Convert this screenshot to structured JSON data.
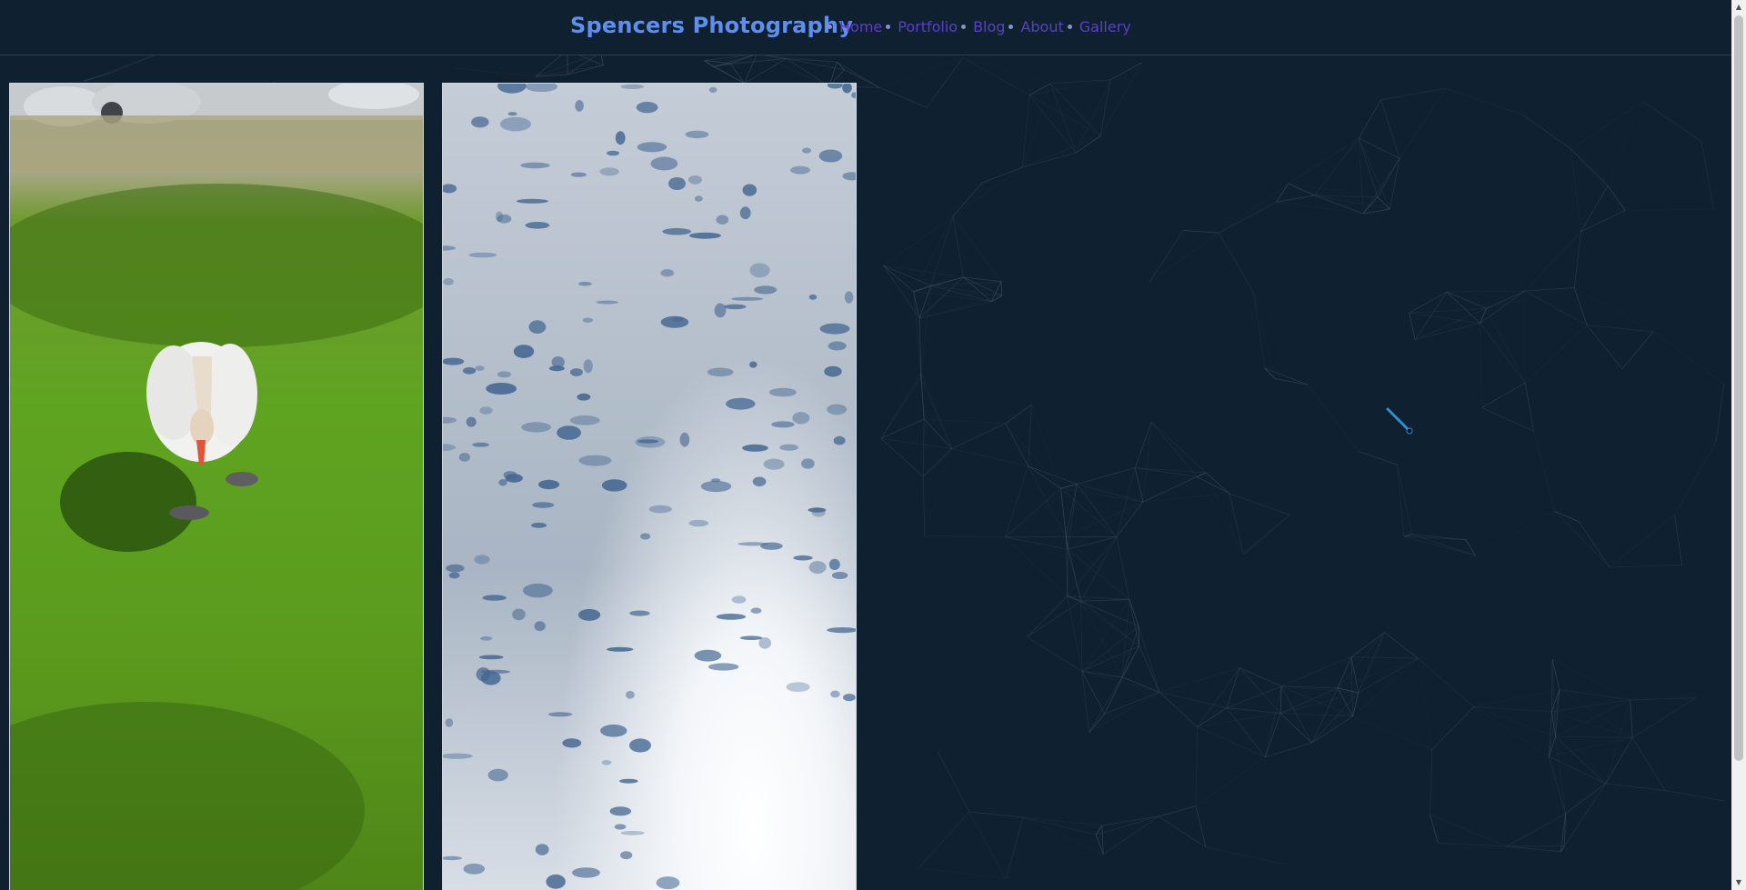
{
  "site": {
    "brand": "Spencers Photography"
  },
  "nav": {
    "items": [
      {
        "label": "Home"
      },
      {
        "label": "Portfolio"
      },
      {
        "label": "Blog"
      },
      {
        "label": "About"
      },
      {
        "label": "Gallery"
      }
    ]
  },
  "gallery": {
    "photos": [
      {
        "subject": "white swan on green grass"
      },
      {
        "subject": "cloudy sky"
      }
    ]
  },
  "colors": {
    "background": "#0f2131",
    "brand": "#5e8ff0",
    "nav_link": "#5b3fc4",
    "network_lines": "#4a5a68"
  },
  "icons": {
    "cursor": "pen-cursor-icon"
  }
}
